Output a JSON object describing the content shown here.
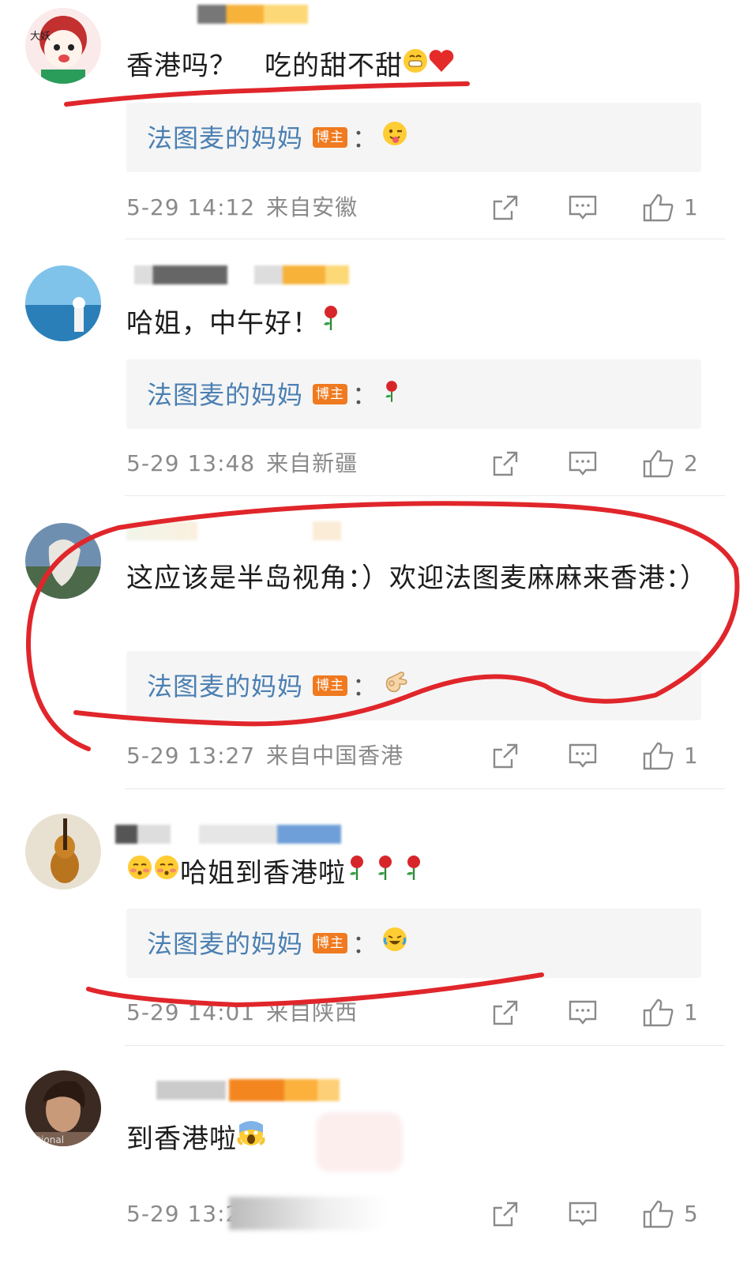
{
  "comments": [
    {
      "text": "香港吗？　吃的甜不甜",
      "text_emojis": [
        "grin-emoji",
        "heart-emoji"
      ],
      "reply": {
        "author": "法图麦的妈妈",
        "badge": "博主",
        "colon": "：",
        "emoji": "tongue-wink-emoji"
      },
      "date": "5-29 14:12",
      "source": "来自安徽",
      "likes": "1"
    },
    {
      "text": "哈姐，中午好！",
      "text_emojis": [
        "rose-emoji"
      ],
      "reply": {
        "author": "法图麦的妈妈",
        "badge": "博主",
        "colon": "：",
        "emoji": "rose-emoji"
      },
      "date": "5-29 13:48",
      "source": "来自新疆",
      "likes": "2"
    },
    {
      "text": "这应该是半岛视角：）欢迎法图麦麻麻来香港：）",
      "text_emojis": [],
      "reply": {
        "author": "法图麦的妈妈",
        "badge": "博主",
        "colon": "：",
        "emoji": "ok-hand-emoji"
      },
      "date": "5-29 13:27",
      "source": "来自中国香港",
      "likes": "1"
    },
    {
      "text": "哈姐到香港啦",
      "text_emojis": [
        "blush-emoji",
        "blush-emoji",
        "rose-emoji",
        "rose-emoji",
        "rose-emoji"
      ],
      "reply": {
        "author": "法图麦的妈妈",
        "badge": "博主",
        "colon": "：",
        "emoji": "laugh-cry-emoji"
      },
      "date": "5-29 14:01",
      "source": "来自陕西",
      "likes": "1"
    },
    {
      "text": "到香港啦",
      "text_emojis": [
        "scream-emoji"
      ],
      "reply": null,
      "date": "5-29 13:2",
      "source": "",
      "likes": "5"
    }
  ],
  "avatar1_text": "大妖",
  "avatar5_text": "ational",
  "colors": {
    "reply_author": "#4a7fb2",
    "badge": "#f07a1f",
    "annotation": "#e0262b",
    "meta": "#8a8a8a"
  }
}
